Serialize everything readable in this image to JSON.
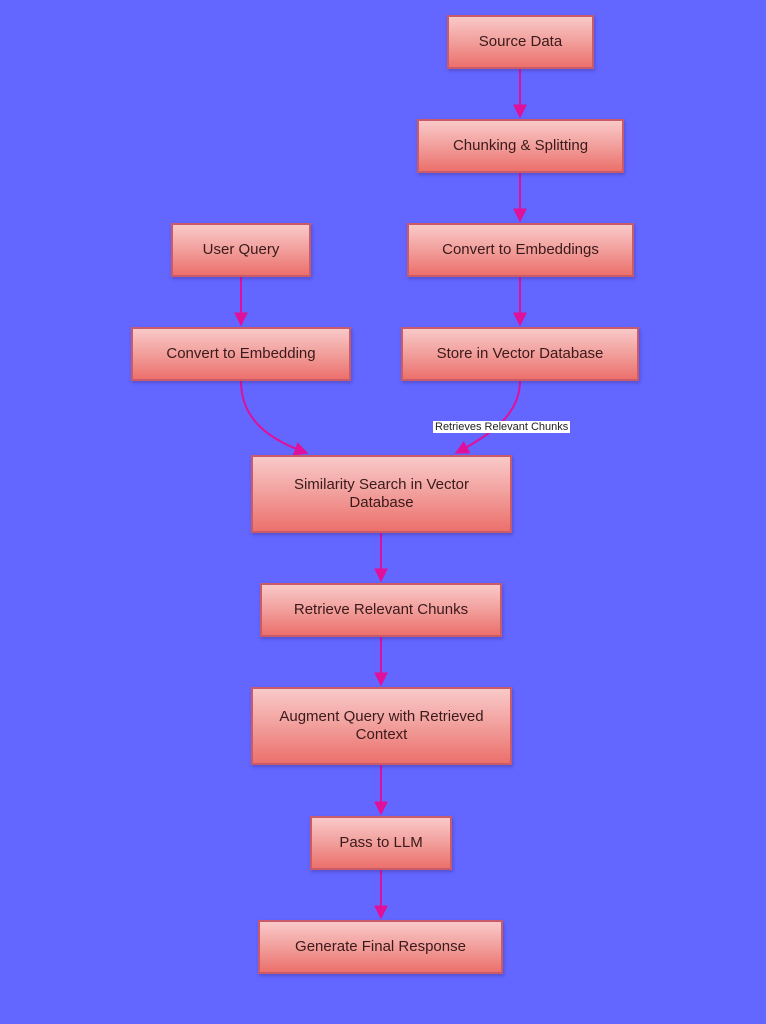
{
  "diagram": {
    "type": "flowchart",
    "nodes": [
      {
        "id": "source",
        "label": "Source Data"
      },
      {
        "id": "chunk",
        "label": "Chunking & Splitting"
      },
      {
        "id": "embeds",
        "label": "Convert to Embeddings"
      },
      {
        "id": "query",
        "label": "User Query"
      },
      {
        "id": "qembed",
        "label": "Convert to Embedding"
      },
      {
        "id": "store",
        "label": "Store in Vector Database"
      },
      {
        "id": "search",
        "label": "Similarity Search in Vector Database"
      },
      {
        "id": "retrieve",
        "label": "Retrieve Relevant Chunks"
      },
      {
        "id": "augment",
        "label": "Augment Query with Retrieved Context"
      },
      {
        "id": "llm",
        "label": "Pass to LLM"
      },
      {
        "id": "response",
        "label": "Generate Final Response"
      }
    ],
    "edges": [
      {
        "from": "source",
        "to": "chunk",
        "label": ""
      },
      {
        "from": "chunk",
        "to": "embeds",
        "label": ""
      },
      {
        "from": "embeds",
        "to": "store",
        "label": ""
      },
      {
        "from": "query",
        "to": "qembed",
        "label": ""
      },
      {
        "from": "qembed",
        "to": "search",
        "label": ""
      },
      {
        "from": "store",
        "to": "search",
        "label": "Retrieves Relevant Chunks"
      },
      {
        "from": "search",
        "to": "retrieve",
        "label": ""
      },
      {
        "from": "retrieve",
        "to": "augment",
        "label": ""
      },
      {
        "from": "augment",
        "to": "llm",
        "label": ""
      },
      {
        "from": "llm",
        "to": "response",
        "label": ""
      }
    ],
    "colors": {
      "background": "#6366ff",
      "edge": "#e0109a",
      "node_top": "#f9c9c9",
      "node_bottom": "#ec706c",
      "node_border": "#c85a6a"
    }
  }
}
